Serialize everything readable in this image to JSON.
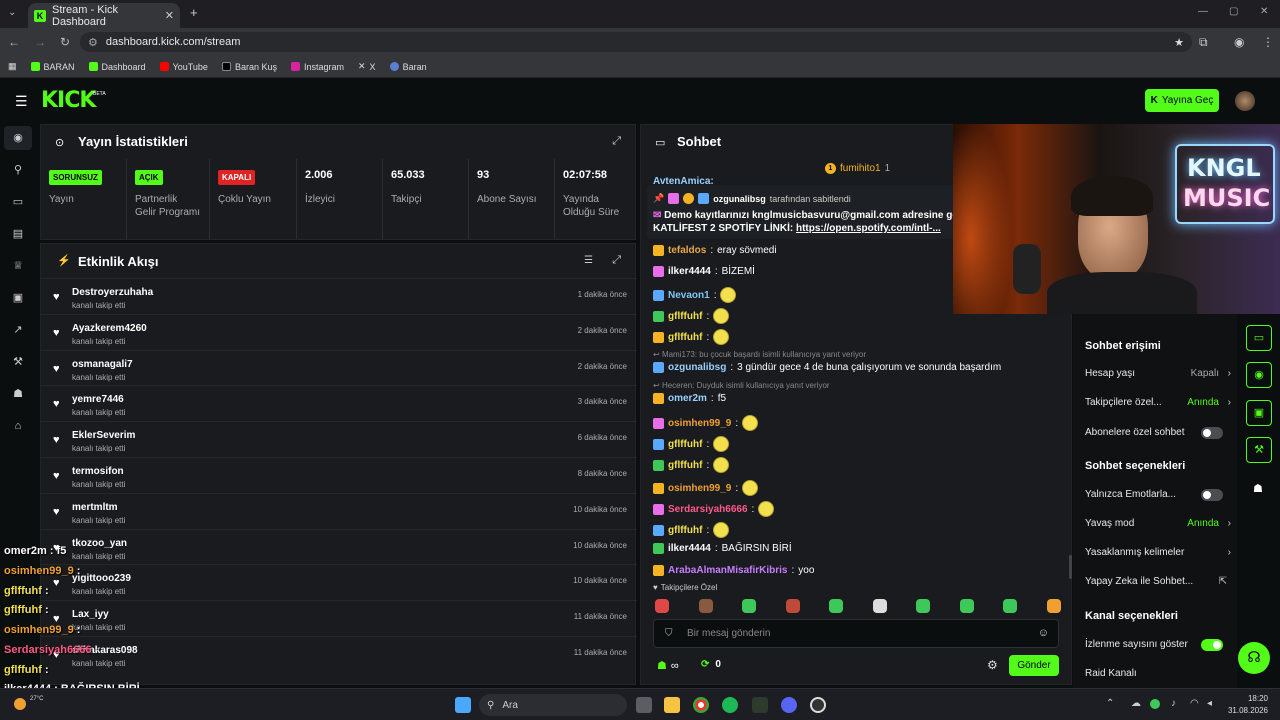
{
  "browser": {
    "tab_title": "Stream - Kick Dashboard",
    "url": "dashboard.kick.com/stream",
    "bookmarks": [
      "BARAN",
      "Dashboard",
      "YouTube",
      "Baran Kuş",
      "Instagram",
      "X",
      "Baran"
    ]
  },
  "header": {
    "logo": "KICK",
    "logo_beta": "BETA",
    "go_live": "Yayına Geç"
  },
  "stats": {
    "title": "Yayın İstatistikleri",
    "cells": [
      {
        "badge": "SORUNSUZ",
        "label": "Yayın"
      },
      {
        "badge": "AÇIK",
        "label": "Partnerlik Gelir Programı"
      },
      {
        "badge": "KAPALI",
        "label": "Çoklu Yayın"
      },
      {
        "value": "2.006",
        "label": "İzleyici"
      },
      {
        "value": "65.033",
        "label": "Takipçi"
      },
      {
        "value": "93",
        "label": "Abone Sayısı"
      },
      {
        "value": "02:07:58",
        "label": "Yayında Olduğu Süre"
      }
    ]
  },
  "activity": {
    "title": "Etkinlik Akışı",
    "items": [
      {
        "name": "Destroyerzuhaha",
        "action": "kanalı takip etti",
        "time": "1 dakika önce"
      },
      {
        "name": "Ayazkerem4260",
        "action": "kanalı takip etti",
        "time": "2 dakika önce"
      },
      {
        "name": "osmanagali7",
        "action": "kanalı takip etti",
        "time": "2 dakika önce"
      },
      {
        "name": "yemre7446",
        "action": "kanalı takip etti",
        "time": "3 dakika önce"
      },
      {
        "name": "EklerSeverim",
        "action": "kanalı takip etti",
        "time": "6 dakika önce"
      },
      {
        "name": "termosifon",
        "action": "kanalı takip etti",
        "time": "8 dakika önce"
      },
      {
        "name": "mertmltm",
        "action": "kanalı takip etti",
        "time": "10 dakika önce"
      },
      {
        "name": "tkozoo_yan",
        "action": "kanalı takip etti",
        "time": "10 dakika önce"
      },
      {
        "name": "yigittooo239",
        "action": "kanalı takip etti",
        "time": "10 dakika önce"
      },
      {
        "name": "Lax_iyy",
        "action": "kanalı takip etti",
        "time": "11 dakika önce"
      },
      {
        "name": "alihakaras098",
        "action": "kanalı takip etti",
        "time": "11 dakika önce"
      }
    ]
  },
  "chat": {
    "title": "Sohbet",
    "top_gifter": "fumihito1",
    "top_gifter_count": "1",
    "partial_user": "AvtenAmica:",
    "pinned_by": "ozgunalibsg",
    "pinned_label": "tarafından sabitlendi",
    "pinned_text": "Demo kayıtlarınızı knglmusicbasvuru@gmail.com adresine göde",
    "pinned_link_label": "KATLİFEST 2 SPOTİFY LİNKİ:",
    "pinned_link": "https://open.spotify.com/intl-...",
    "messages": [
      {
        "user": "tefaldos",
        "text": "eray sövmedi",
        "color": "#e8a848"
      },
      {
        "user": "ilker4444",
        "text": "BİZEMİ",
        "color": "#ffffff"
      },
      {
        "user": "Nevaon1",
        "text": "",
        "color": "#7ec8f5"
      },
      {
        "user": "gflffuhf",
        "text": "",
        "color": "#f2e04e"
      },
      {
        "user": "gflffuhf",
        "text": "",
        "color": "#f2e04e"
      },
      {
        "reply": "Mami173: bu çocuk başardı isimli kullanıcıya yanıt veriyor"
      },
      {
        "user": "ozgunalibsg",
        "text": "3 gündür gece 4 de buna çalışıyorum ve sonunda başardım",
        "color": "#9ad0ff"
      },
      {
        "reply": "Heceren: Duyduk isimli kullanıcıya yanıt veriyor"
      },
      {
        "user": "omer2m",
        "text": "f5",
        "color": "#9ad0ff"
      },
      {
        "user": "osimhen99_9",
        "text": "",
        "color": "#f0a030"
      },
      {
        "user": "gflffuhf",
        "text": "",
        "color": "#f2e04e"
      },
      {
        "user": "gflffuhf",
        "text": "",
        "color": "#f2e04e"
      },
      {
        "user": "osimhen99_9",
        "text": "",
        "color": "#f0a030"
      },
      {
        "user": "Serdarsiyah6666",
        "text": "",
        "color": "#ff5a8a"
      },
      {
        "user": "gflffuhf",
        "text": "",
        "color": "#f2e04e"
      },
      {
        "user": "ilker4444",
        "text": "BAĞIRSIN BİRİ",
        "color": "#ffffff"
      },
      {
        "user": "ArabaAlmanMisafirKibris",
        "text": "yoo",
        "color": "#c77dff"
      }
    ],
    "followers_only": "Takipçilere Özel",
    "input_placeholder": "Bir mesaj gönderin",
    "infinity": "∞",
    "points": "0",
    "send": "Gönder"
  },
  "settings": {
    "access_title": "Sohbet erişimi",
    "account_age": "Hesap yaşı",
    "account_age_val": "Kapalı",
    "followers_only": "Takipçilere özel...",
    "followers_only_val": "Anında",
    "subs_only": "Abonelere özel sohbet",
    "options_title": "Sohbet seçenekleri",
    "emotes_only": "Yalnızca Emotlarla...",
    "slow_mode": "Yavaş mod",
    "slow_mode_val": "Anında",
    "banned_words": "Yasaklanmış kelimeler",
    "ai": "Yapay Zeka ile Sohbet...",
    "channel_title": "Kanal seçenekleri",
    "show_viewers": "İzlenme sayısını göster",
    "raid": "Raid Kanalı"
  },
  "cam": {
    "sign_line1": "KNGL",
    "sign_line2": "MUSIC"
  },
  "overlay": [
    {
      "user": "omer2m",
      "text": ": f5",
      "color": "#ffffff"
    },
    {
      "user": "osimhen99_9",
      "text": ":",
      "color": "#f0a030"
    },
    {
      "user": "gflffuhf",
      "text": ":",
      "color": "#f2e04e"
    },
    {
      "user": "gflffuhf",
      "text": ":",
      "color": "#f2e04e"
    },
    {
      "user": "osimhen99_9",
      "text": ":",
      "color": "#f0a030"
    },
    {
      "user": "Serdarsiyah6666",
      "text": ":",
      "color": "#ff5a8a"
    },
    {
      "user": "gflffuhf",
      "text": ":",
      "color": "#f2e04e"
    },
    {
      "user": "ilker4444",
      "text": ": BAĞIRSIN BİRİ",
      "color": "#ffffff"
    },
    {
      "user": "ArabaAlmanMisafirKibris",
      "text": ": yoo",
      "color": "#c77dff"
    }
  ],
  "taskbar": {
    "search": "Ara",
    "weather": "27°C",
    "time": "18:20",
    "date": "31.08.2026"
  }
}
